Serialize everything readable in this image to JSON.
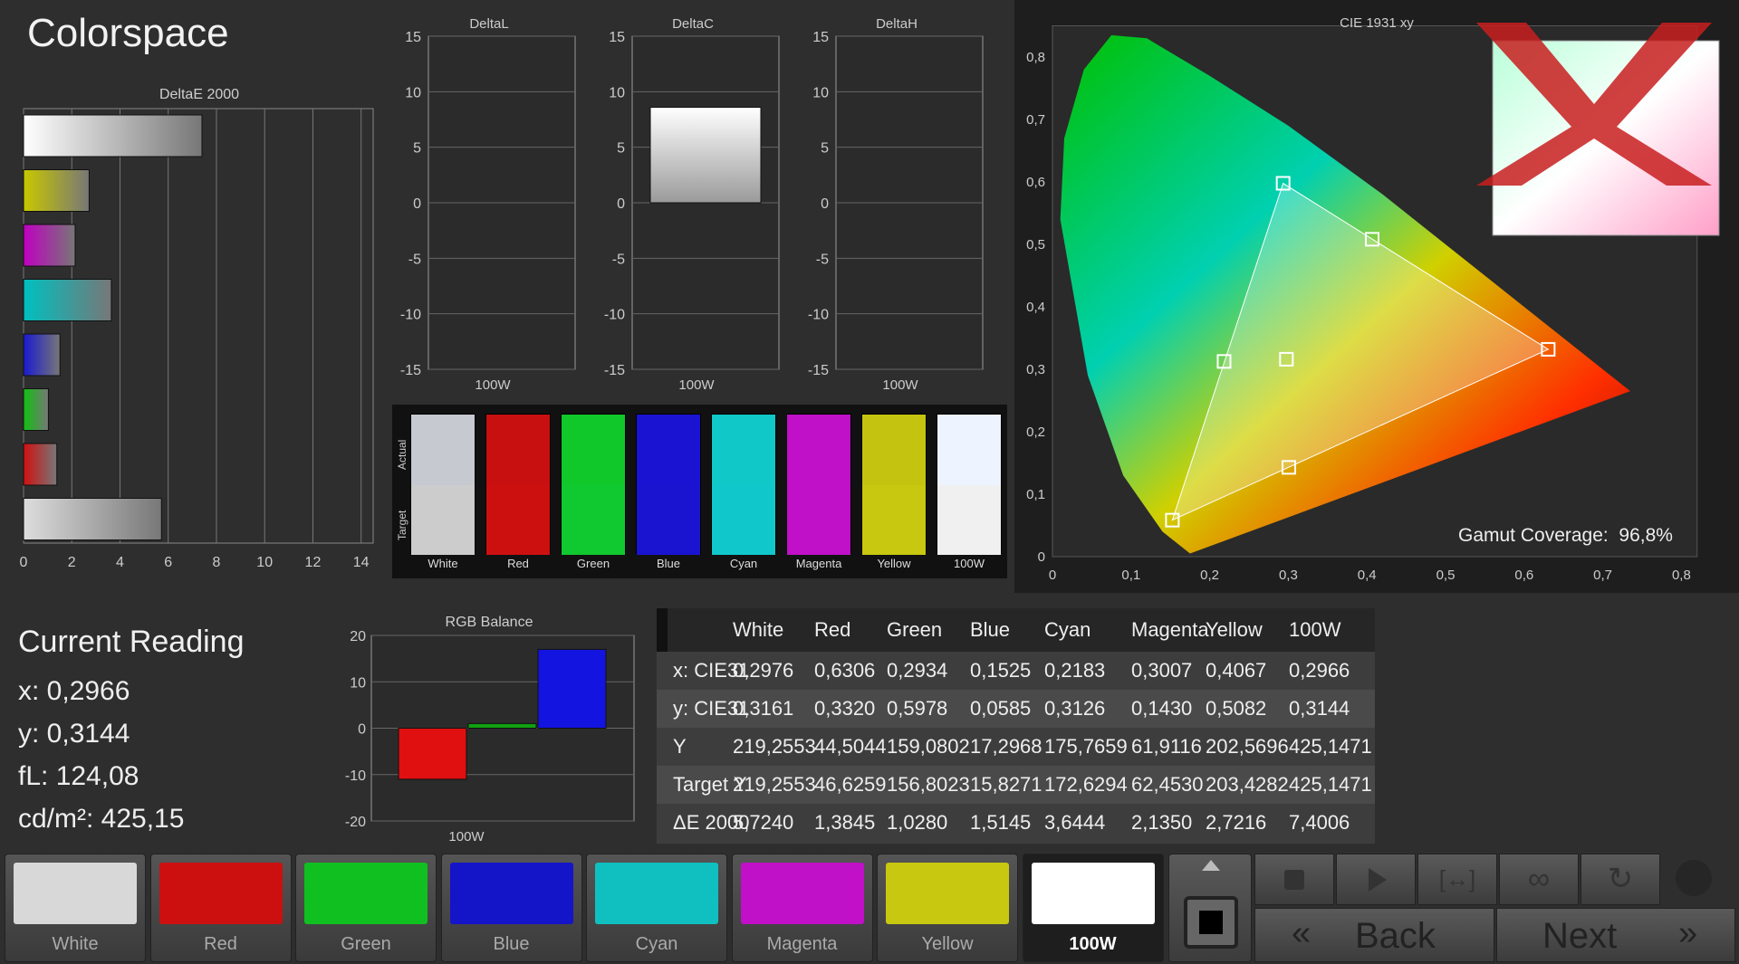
{
  "page": {
    "title": "Colorspace",
    "current_reading": "Current Reading",
    "x": "x: 0,2966",
    "y": "y: 0,3144",
    "fl": "fL: 124,08",
    "cdm": "cd/m²: 425,15"
  },
  "deltae": {
    "title": "DeltaE 2000",
    "ticks": [
      "0",
      "2",
      "4",
      "6",
      "8",
      "10",
      "12",
      "14"
    ],
    "bars": [
      {
        "name": "White",
        "value": 7.4,
        "color": "#ffffff"
      },
      {
        "name": "Yellow",
        "value": 2.72,
        "color": "#c8c800"
      },
      {
        "name": "Magenta",
        "value": 2.14,
        "color": "#c000c0"
      },
      {
        "name": "Cyan",
        "value": 3.64,
        "color": "#00c0c0"
      },
      {
        "name": "Blue",
        "value": 1.51,
        "color": "#1a1ad0"
      },
      {
        "name": "Green",
        "value": 1.03,
        "color": "#10c010"
      },
      {
        "name": "Red",
        "value": 1.38,
        "color": "#d01010"
      },
      {
        "name": "White",
        "value": 5.72,
        "color": "#dddddd"
      }
    ]
  },
  "small_charts": [
    {
      "title": "DeltaL",
      "x_label": "100W",
      "ticks": [
        "15",
        "10",
        "5",
        "0",
        "-5",
        "-10",
        "-15"
      ],
      "value": 0
    },
    {
      "title": "DeltaC",
      "x_label": "100W",
      "ticks": [
        "15",
        "10",
        "5",
        "0",
        "-5",
        "-10",
        "-15"
      ],
      "value": 8.6
    },
    {
      "title": "DeltaH",
      "x_label": "100W",
      "ticks": [
        "15",
        "10",
        "5",
        "0",
        "-5",
        "-10",
        "-15"
      ],
      "value": 0
    }
  ],
  "swatch_panel": {
    "actual": "Actual",
    "target": "Target",
    "items": [
      {
        "name": "White",
        "actual": "#c6c9d0",
        "target": "#cccccc"
      },
      {
        "name": "Red",
        "actual": "#c81010",
        "target": "#cc1010"
      },
      {
        "name": "Green",
        "actual": "#10c82a",
        "target": "#10c830"
      },
      {
        "name": "Blue",
        "actual": "#1a14d2",
        "target": "#1a14d0"
      },
      {
        "name": "Cyan",
        "actual": "#10c8c8",
        "target": "#10c8cc"
      },
      {
        "name": "Magenta",
        "actual": "#c010c8",
        "target": "#c010c8"
      },
      {
        "name": "Yellow",
        "actual": "#c4c410",
        "target": "#c8c810"
      },
      {
        "name": "100W",
        "actual": "#eef4ff",
        "target": "#f0f0f0"
      }
    ]
  },
  "cie": {
    "title": "CIE 1931 xy",
    "gamut_label": "Gamut Coverage:",
    "gamut_value": "96,8%",
    "x_ticks": [
      "0",
      "0,1",
      "0,2",
      "0,3",
      "0,4",
      "0,5",
      "0,6",
      "0,7",
      "0,8"
    ],
    "y_ticks": [
      "0,8",
      "0,7",
      "0,6",
      "0,5",
      "0,4",
      "0,3",
      "0,2",
      "0,1",
      "0"
    ],
    "points": [
      {
        "x": 0.6306,
        "y": 0.332
      },
      {
        "x": 0.2934,
        "y": 0.5978
      },
      {
        "x": 0.1525,
        "y": 0.0585
      },
      {
        "x": 0.2183,
        "y": 0.3126
      },
      {
        "x": 0.3007,
        "y": 0.143
      },
      {
        "x": 0.4067,
        "y": 0.5082
      },
      {
        "x": 0.2976,
        "y": 0.3161
      }
    ]
  },
  "rgb_balance": {
    "title": "RGB Balance",
    "x_label": "100W",
    "ticks": [
      "20",
      "10",
      "0",
      "-10",
      "-20"
    ],
    "values": [
      {
        "name": "Red",
        "value": -11,
        "color": "#e01010"
      },
      {
        "name": "Green",
        "value": 1,
        "color": "#10a010"
      },
      {
        "name": "Blue",
        "value": 17,
        "color": "#1414e0"
      }
    ]
  },
  "table": {
    "headers": [
      "",
      "White",
      "Red",
      "Green",
      "Blue",
      "Cyan",
      "Magenta",
      "Yellow",
      "100W"
    ],
    "rows": [
      [
        "x: CIE31",
        "0,2976",
        "0,6306",
        "0,2934",
        "0,1525",
        "0,2183",
        "0,3007",
        "0,4067",
        "0,2966"
      ],
      [
        "y: CIE31",
        "0,3161",
        "0,3320",
        "0,5978",
        "0,0585",
        "0,3126",
        "0,1430",
        "0,5082",
        "0,3144"
      ],
      [
        "Y",
        "219,2553",
        "44,5044",
        "159,0802",
        "17,2968",
        "175,7659",
        "61,9116",
        "202,5696",
        "425,1471"
      ],
      [
        "Target Y",
        "219,2553",
        "46,6259",
        "156,8023",
        "15,8271",
        "172,6294",
        "62,4530",
        "203,4282",
        "425,1471"
      ],
      [
        "ΔE 2000",
        "5,7240",
        "1,3845",
        "1,0280",
        "1,5145",
        "3,6444",
        "2,1350",
        "2,7216",
        "7,4006"
      ]
    ]
  },
  "buttons": [
    {
      "label": "White",
      "color": "#d8d8d8"
    },
    {
      "label": "Red",
      "color": "#cc1010"
    },
    {
      "label": "Green",
      "color": "#10c020"
    },
    {
      "label": "Blue",
      "color": "#1414c8"
    },
    {
      "label": "Cyan",
      "color": "#10c0c0"
    },
    {
      "label": "Magenta",
      "color": "#c010c8"
    },
    {
      "label": "Yellow",
      "color": "#c8c810"
    },
    {
      "label": "100W",
      "color": "#ffffff"
    }
  ],
  "nav": {
    "back": "Back",
    "next": "Next",
    "back_chev": "«",
    "next_chev": "»"
  }
}
